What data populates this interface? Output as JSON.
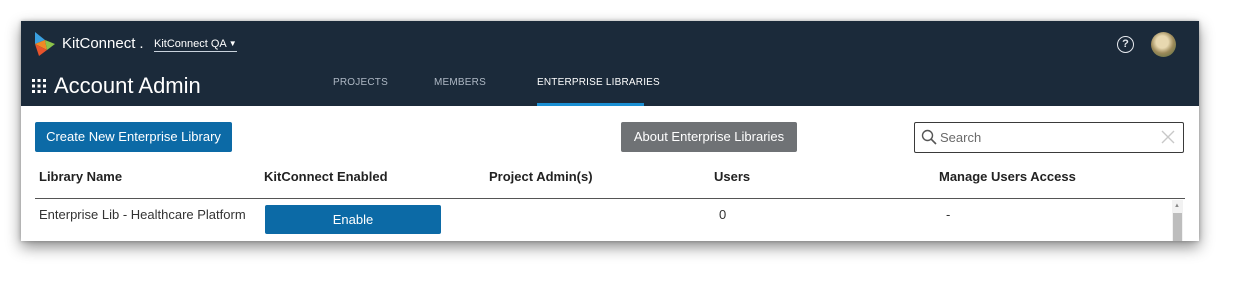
{
  "app": {
    "brand": "KitConnect",
    "brand_dot": ".",
    "account": "KitConnect QA",
    "help_glyph": "?"
  },
  "header": {
    "title": "Account Admin",
    "tabs": [
      {
        "label": "PROJECTS",
        "active": false
      },
      {
        "label": "MEMBERS",
        "active": false
      },
      {
        "label": "ENTERPRISE LIBRARIES",
        "active": true
      }
    ]
  },
  "toolbar": {
    "create_label": "Create New Enterprise Library",
    "about_label": "About Enterprise Libraries",
    "search_placeholder": "Search"
  },
  "table": {
    "columns": [
      "Library Name",
      "KitConnect Enabled",
      "Project Admin(s)",
      "Users",
      "Manage Users Access"
    ],
    "rows": [
      {
        "name": "Enterprise Lib - Healthcare Platform",
        "enable_label": "Enable",
        "admins": "",
        "users": "0",
        "manage": "-"
      }
    ]
  },
  "icons": {
    "logo": "kitconnect-logo-icon",
    "help": "help-icon",
    "avatar": "user-avatar",
    "grid": "app-grid-icon",
    "search": "search-icon",
    "clear": "clear-icon",
    "caret": "chevron-down-icon"
  },
  "colors": {
    "topbar": "#1b2a3a",
    "accent": "#1a8fd3",
    "primary_button": "#0c6aa6",
    "secondary_button": "#6f7275"
  }
}
